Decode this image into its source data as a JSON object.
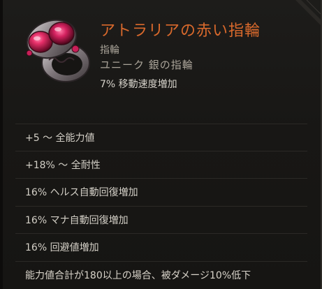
{
  "item": {
    "name": "アトラリアの赤い指輪",
    "slot": "指輪",
    "rarity_type": "ユニーク 銀の指輪",
    "implicit": "7% 移動速度増加",
    "affixes": [
      "+5 〜 全能力値",
      "+18% 〜 全耐性",
      "16% ヘルス自動回復増加",
      "16% マナ自動回復増加",
      "16% 回避値増加",
      "能力値合計が180以上の場合、被ダメージ10%低下"
    ]
  },
  "colors": {
    "title": "#d9692c",
    "gem": "#e0306a",
    "text": "#d3cfc6"
  },
  "icon": "silver-ring-with-red-gems-icon"
}
